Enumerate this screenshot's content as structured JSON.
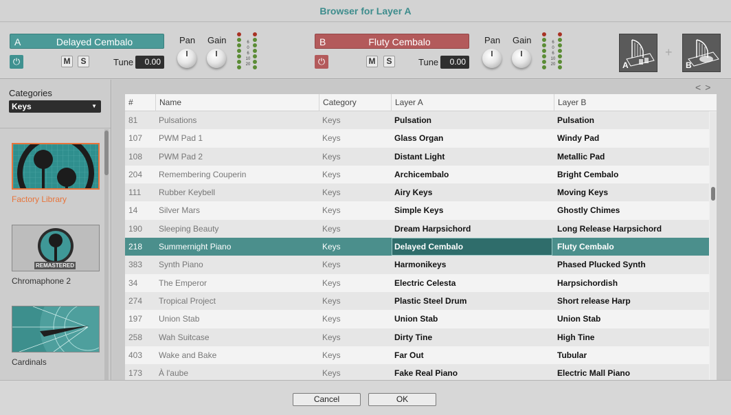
{
  "window": {
    "title": "Browser for Layer A"
  },
  "layerA": {
    "letter": "A",
    "name": "Delayed Cembalo",
    "mute": "M",
    "solo": "S",
    "tune_label": "Tune",
    "tune_value": "0.00",
    "pan_label": "Pan",
    "gain_label": "Gain",
    "color": "#4b9a98"
  },
  "layerB": {
    "letter": "B",
    "name": "Fluty Cembalo",
    "mute": "M",
    "solo": "S",
    "tune_label": "Tune",
    "tune_value": "0.00",
    "pan_label": "Pan",
    "gain_label": "Gain",
    "color": "#b35a5b"
  },
  "meter_scale": [
    "6",
    "0",
    "6",
    "10",
    "20"
  ],
  "thumbs": {
    "a_letter": "A",
    "b_letter": "B",
    "plus": "+"
  },
  "categories": {
    "label": "Categories",
    "selected": "Keys"
  },
  "libraries": [
    {
      "label": "Factory Library",
      "selected": true
    },
    {
      "label": "Chromaphone 2",
      "badge": "REMASTERED"
    },
    {
      "label": "Cardinals"
    }
  ],
  "nav": {
    "prev": "<",
    "next": ">"
  },
  "table": {
    "headers": [
      "#",
      "Name",
      "Category",
      "Layer A",
      "Layer B"
    ],
    "rows": [
      [
        "81",
        "Pulsations",
        "Keys",
        "Pulsation",
        "Pulsation"
      ],
      [
        "107",
        "PWM Pad 1",
        "Keys",
        "Glass Organ",
        "Windy Pad"
      ],
      [
        "108",
        "PWM Pad 2",
        "Keys",
        "Distant Light",
        "Metallic Pad"
      ],
      [
        "204",
        "Remembering Couperin",
        "Keys",
        "Archicembalo",
        "Bright Cembalo"
      ],
      [
        "111",
        "Rubber Keybell",
        "Keys",
        "Airy Keys",
        "Moving Keys"
      ],
      [
        "14",
        "Silver Mars",
        "Keys",
        "Simple Keys",
        "Ghostly Chimes"
      ],
      [
        "190",
        "Sleeping Beauty",
        "Keys",
        "Dream Harpsichord",
        "Long Release Harpsichord"
      ],
      [
        "218",
        "Summernight Piano",
        "Keys",
        "Delayed Cembalo",
        "Fluty Cembalo"
      ],
      [
        "383",
        "Synth Piano",
        "Keys",
        "Harmonikeys",
        "Phased Plucked Synth"
      ],
      [
        "34",
        "The Emperor",
        "Keys",
        "Electric Celesta",
        "Harpsichordish"
      ],
      [
        "274",
        "Tropical Project",
        "Keys",
        "Plastic Steel Drum",
        "Short release Harp"
      ],
      [
        "197",
        "Union Stab",
        "Keys",
        "Union Stab",
        "Union Stab"
      ],
      [
        "258",
        "Wah Suitcase",
        "Keys",
        "Dirty Tine",
        "High Tine"
      ],
      [
        "403",
        "Wake and Bake",
        "Keys",
        "Far Out",
        "Tubular"
      ],
      [
        "173",
        "À l'aube",
        "Keys",
        "Fake Real Piano",
        "Electric Mall Piano"
      ]
    ],
    "selected_index": 7
  },
  "footer": {
    "cancel": "Cancel",
    "ok": "OK"
  }
}
